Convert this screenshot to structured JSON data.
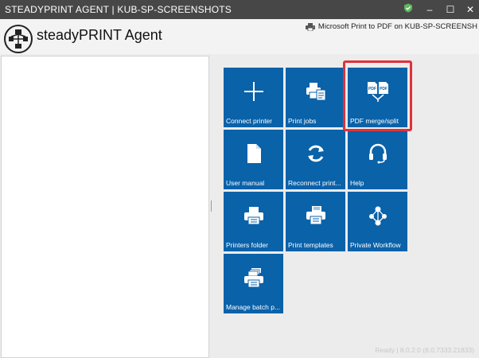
{
  "window": {
    "title": "STEADYPRINT AGENT | KUB-SP-SCREENSHOTS",
    "controls": {
      "minimize": "–",
      "maximize": "☐",
      "close": "✕"
    }
  },
  "header": {
    "app_name": "steadyPRINT Agent",
    "default_printer": "Microsoft Print to PDF on KUB-SP-SCREENSH"
  },
  "tiles": [
    {
      "label": "Connect printer",
      "icon": "plus-icon"
    },
    {
      "label": "Print jobs",
      "icon": "print-jobs-icon"
    },
    {
      "label": "PDF merge/split",
      "icon": "pdf-merge-icon"
    },
    {
      "label": "User manual",
      "icon": "document-icon"
    },
    {
      "label": "Reconnect print...",
      "icon": "refresh-icon"
    },
    {
      "label": "Help",
      "icon": "headset-icon"
    },
    {
      "label": "Printers folder",
      "icon": "printer-icon"
    },
    {
      "label": "Print templates",
      "icon": "print-template-icon"
    },
    {
      "label": "Private Workflow",
      "icon": "workflow-icon"
    },
    {
      "label": "Manage batch p...",
      "icon": "batch-printer-icon"
    }
  ],
  "status_bar": {
    "text": "Ready | 8.0.2.0 (8.0.7333.21833)"
  },
  "colors": {
    "tile": "#0a62a9",
    "titlebar": "#474747",
    "highlight": "#e0313a"
  }
}
